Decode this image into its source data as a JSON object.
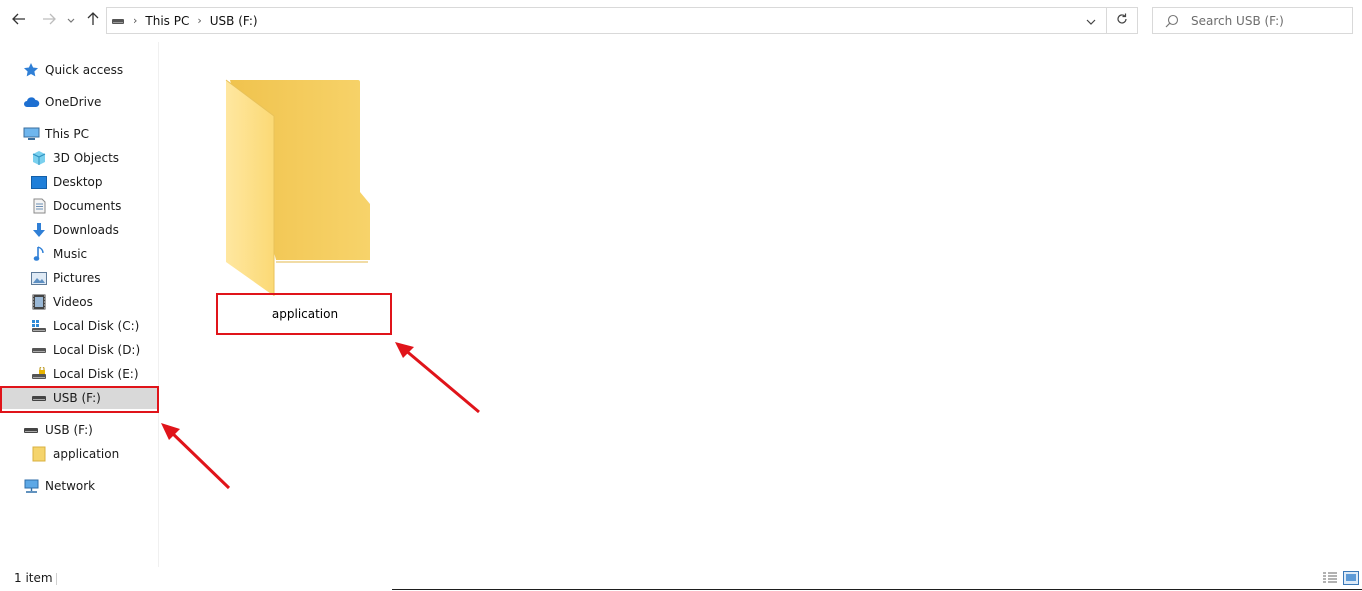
{
  "toolbar": {
    "back_icon": "arrow-left-icon",
    "forward_icon": "arrow-right-icon",
    "recent_icon": "chevron-down-icon",
    "up_icon": "arrow-up-icon"
  },
  "address_bar": {
    "drive_icon": "drive-icon",
    "breadcrumbs": [
      "This PC",
      "USB (F:)"
    ],
    "dropdown_icon": "chevron-down-icon",
    "refresh_icon": "refresh-icon"
  },
  "search": {
    "placeholder": "Search USB (F:)",
    "icon": "search-icon"
  },
  "sidebar": {
    "items": [
      {
        "label": "Quick access",
        "icon": "star-icon"
      },
      {
        "label": "OneDrive",
        "icon": "cloud-icon"
      },
      {
        "label": "This PC",
        "icon": "computer-icon"
      },
      {
        "label": "3D Objects",
        "icon": "cube-icon"
      },
      {
        "label": "Desktop",
        "icon": "desktop-icon"
      },
      {
        "label": "Documents",
        "icon": "document-icon"
      },
      {
        "label": "Downloads",
        "icon": "download-icon"
      },
      {
        "label": "Music",
        "icon": "music-icon"
      },
      {
        "label": "Pictures",
        "icon": "picture-icon"
      },
      {
        "label": "Videos",
        "icon": "video-icon"
      },
      {
        "label": "Local Disk (C:)",
        "icon": "windows-drive-icon"
      },
      {
        "label": "Local Disk (D:)",
        "icon": "drive-icon"
      },
      {
        "label": "Local Disk (E:)",
        "icon": "locked-drive-icon"
      },
      {
        "label": "USB (F:)",
        "icon": "usb-drive-icon",
        "selected": true
      },
      {
        "label": "USB (F:)",
        "icon": "usb-drive-icon"
      },
      {
        "label": "application",
        "icon": "folder-icon"
      },
      {
        "label": "Network",
        "icon": "network-icon"
      }
    ]
  },
  "content": {
    "items": [
      {
        "name": "application",
        "type": "folder",
        "icon": "folder-icon"
      }
    ]
  },
  "status": {
    "item_count": "1 item",
    "details_view_icon": "details-view-icon",
    "large_icons_view_icon": "large-icons-view-icon"
  },
  "annotations": {
    "highlight_color": "#e0141a"
  },
  "colors": {
    "selection": "#d9d9d9",
    "folder_back": "#f2cd5c",
    "folder_front": "#ffe089"
  }
}
